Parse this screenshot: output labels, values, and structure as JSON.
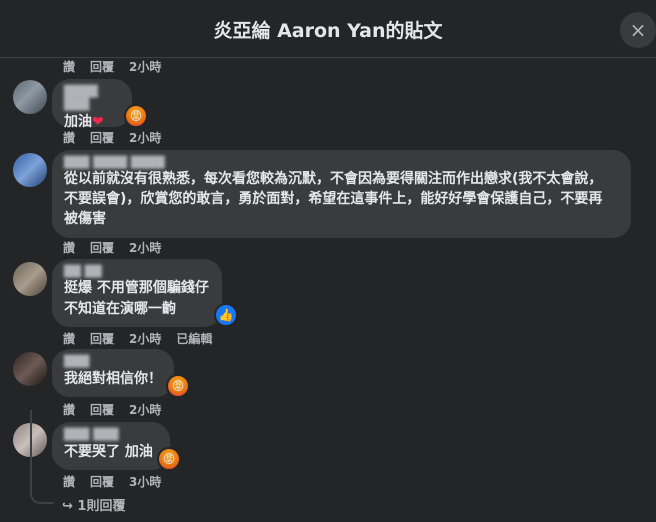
{
  "header": {
    "title": "炎亞綸 Aaron Yan的貼文"
  },
  "close_icon": "×",
  "top_meta": {
    "like": "讚",
    "reply": "回覆",
    "time": "2小時"
  },
  "comments": [
    {
      "author": "████ ███",
      "text": "加油",
      "heart": "❤",
      "like": "讚",
      "reply": "回覆",
      "time": "2小時",
      "reaction": "angry"
    },
    {
      "author": "███ ████ ████",
      "text_lines": [
        "從以前就沒有很熟悉，每次看您較為沉默，不會因為要得關注而作出戀求(我不太會說，",
        "不要誤會)，欣賞您的敢言，勇於面對，希望在這事件上，能好好學會保護自己，不要再",
        "被傷害"
      ],
      "like": "讚",
      "reply": "回覆",
      "time": "2小時"
    },
    {
      "author": "██ ██",
      "text_lines": [
        "挺爆 不用管那個騙錢仔",
        "不知道在演哪一齣"
      ],
      "like": "讚",
      "reply": "回覆",
      "time": "2小時",
      "edited": "已編輯",
      "reaction": "like"
    },
    {
      "author": "███",
      "text": "我絕對相信你！",
      "like": "讚",
      "reply": "回覆",
      "time": "2小時",
      "reaction": "angry"
    },
    {
      "author": "███ ███",
      "text": "不要哭了 加油",
      "like": "讚",
      "reply": "回覆",
      "time": "3小時",
      "reaction": "angry"
    }
  ],
  "replies_link": "↪ 1則回覆",
  "colors": {
    "background": "#242526",
    "bubble": "#3a3b3c",
    "text": "#e4e6eb",
    "meta": "#b0b3b8",
    "like_blue": "#1877f2",
    "heart": "#f02849"
  }
}
